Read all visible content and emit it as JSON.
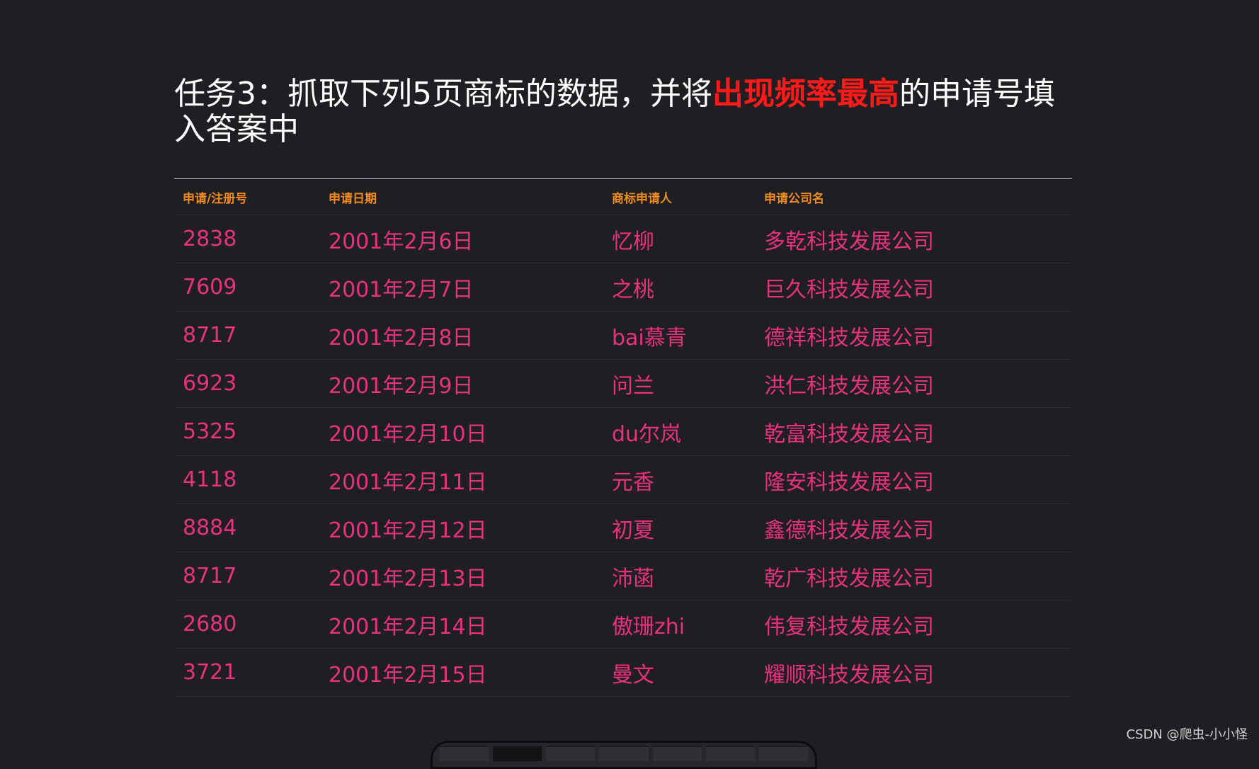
{
  "task": {
    "title_before": "任务3：抓取下列5页商标的数据，并将",
    "title_highlight": "出现频率最高",
    "title_after": "的申请号填入答案中"
  },
  "table": {
    "headers": [
      "申请/注册号",
      "申请日期",
      "商标申请人",
      "申请公司名"
    ],
    "rows": [
      [
        "2838",
        "2001年2月6日",
        "忆柳",
        "多乾科技发展公司"
      ],
      [
        "7609",
        "2001年2月7日",
        "之桃",
        "巨久科技发展公司"
      ],
      [
        "8717",
        "2001年2月8日",
        "bai慕青",
        "德祥科技发展公司"
      ],
      [
        "6923",
        "2001年2月9日",
        "问兰",
        "洪仁科技发展公司"
      ],
      [
        "5325",
        "2001年2月10日",
        "du尔岚",
        "乾富科技发展公司"
      ],
      [
        "4118",
        "2001年2月11日",
        "元香",
        "隆安科技发展公司"
      ],
      [
        "8884",
        "2001年2月12日",
        "初夏",
        "鑫德科技发展公司"
      ],
      [
        "8717",
        "2001年2月13日",
        "沛菡",
        "乾广科技发展公司"
      ],
      [
        "2680",
        "2001年2月14日",
        "傲珊zhi",
        "伟复科技发展公司"
      ],
      [
        "3721",
        "2001年2月15日",
        "曼文",
        "耀顺科技发展公司"
      ]
    ]
  },
  "watermark": "CSDN @爬虫-小小怪",
  "colors": {
    "background": "#1f1f23",
    "title": "#ffffff",
    "highlight": "#ff1a1a",
    "header": "#f08c1c",
    "cell": "#e8317f"
  }
}
